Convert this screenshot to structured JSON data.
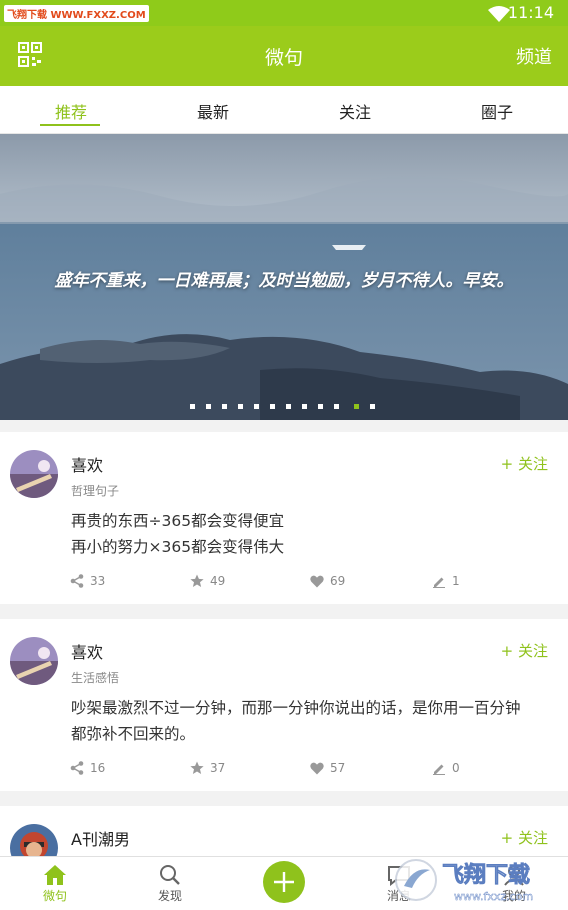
{
  "status_bar": {
    "time": "11:14",
    "watermark": "飞翔下载 WWW.FXXZ.COM"
  },
  "app_bar": {
    "title": "微句",
    "channel_label": "频道"
  },
  "tabs": [
    {
      "label": "推荐",
      "active": true
    },
    {
      "label": "最新",
      "active": false
    },
    {
      "label": "关注",
      "active": false
    },
    {
      "label": "圈子",
      "active": false
    }
  ],
  "banner": {
    "caption": "盛年不重来，一日难再晨；及时当勉励，岁月不待人。早安。",
    "dot_count": 12,
    "active_dot": 10
  },
  "posts": [
    {
      "username": "喜欢",
      "category": "哲理句子",
      "follow_label": "+ 关注",
      "lines": [
        "再贵的东西÷365都会变得便宜",
        "再小的努力×365都会变得伟大"
      ],
      "shares": "33",
      "stars": "49",
      "likes": "69",
      "comments": "1"
    },
    {
      "username": "喜欢",
      "category": "生活感悟",
      "follow_label": "+ 关注",
      "lines": [
        "吵架最激烈不过一分钟，而那一分钟你说出的话，是你用一百分钟",
        "都弥补不回来的。"
      ],
      "shares": "16",
      "stars": "37",
      "likes": "57",
      "comments": "0"
    },
    {
      "username": "A刊潮男",
      "follow_label": "+ 关注"
    }
  ],
  "bottom_nav": [
    {
      "label": "微句",
      "icon": "home-icon",
      "active": true
    },
    {
      "label": "发现",
      "icon": "search-icon",
      "active": false
    },
    {
      "label": "",
      "icon": "plus-icon",
      "active": false
    },
    {
      "label": "消息",
      "icon": "message-icon",
      "active": false
    },
    {
      "label": "我的",
      "icon": "user-icon",
      "active": false
    }
  ],
  "corner_watermark": {
    "brand": "飞翔下载",
    "url": "www.fxxz.com"
  },
  "colors": {
    "accent": "#8fc21c",
    "appbar": "#9bcc1b"
  }
}
